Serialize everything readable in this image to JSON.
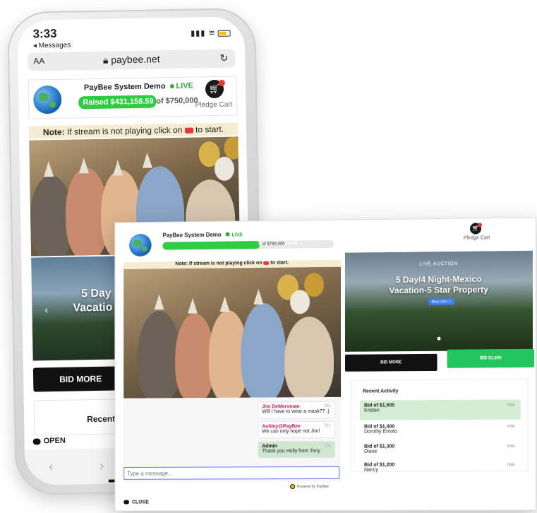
{
  "phone": {
    "status": {
      "time": "3:33",
      "back_label": "Messages"
    },
    "url_bar": {
      "text_size": "AA",
      "url": "paybee.net"
    },
    "header": {
      "title": "PayBee System Demo",
      "live": "LIVE",
      "raised": "Raised $431,158.59",
      "goal": "of $750,000",
      "cart_label": "Pledge Cart"
    },
    "note": {
      "prefix": "Note:",
      "text": "If stream is not playing click on",
      "suffix": "to start."
    },
    "auction_partial": {
      "line1": "5 Day",
      "line2": "Vacatio"
    },
    "bid_more": "BID MORE",
    "recent_label": "Recent Activ",
    "open_label": "OPEN"
  },
  "desktop": {
    "header": {
      "title": "PayBee System Demo",
      "live": "LIVE",
      "raised": "Raised $431,158.59",
      "goal": "of $750,000",
      "progress_pct": 57,
      "cart_label": "Pledge Cart"
    },
    "note": {
      "prefix": "Note:",
      "text": "If stream is not playing click on",
      "suffix": "to start."
    },
    "auction": {
      "label": "LIVE AUCTION",
      "title_line1": "5 Day/4 Night-Mexico",
      "title_line2": "Vacation-5 Star Property",
      "more_info": "More Info"
    },
    "bid_more": "BID MORE",
    "bid_button": "BID $1,600",
    "activity": {
      "title": "Recent Activity",
      "rows": [
        {
          "amount": "Bid of $1,500",
          "name": "Kristen",
          "time": "now"
        },
        {
          "amount": "Bid of $1,400",
          "name": "Dorothy Emoto",
          "time": "now"
        },
        {
          "amount": "Bid of $1,300",
          "name": "Diane",
          "time": "now"
        },
        {
          "amount": "Bid of $1,200",
          "name": "Nancy",
          "time": "now"
        }
      ]
    },
    "chat": {
      "messages": [
        {
          "user": "Jim DeMersman",
          "text": "Will I have to wear a mask?? :)",
          "ago": "58s"
        },
        {
          "user": "Ashley@PayBee",
          "text": "We can only hope not Jim!",
          "ago": "31s"
        },
        {
          "user": "Admin",
          "text": "Thank you Holly from Tony",
          "ago": "13s"
        }
      ],
      "input_placeholder": "Type a message...",
      "powered_by": "Powered by PayBee",
      "close_label": "CLOSE"
    }
  },
  "colors": {
    "accent_green": "#2ecc40",
    "live_green": "#2fae3c",
    "note_bg": "#f5ecd2",
    "dark": "#111111"
  }
}
